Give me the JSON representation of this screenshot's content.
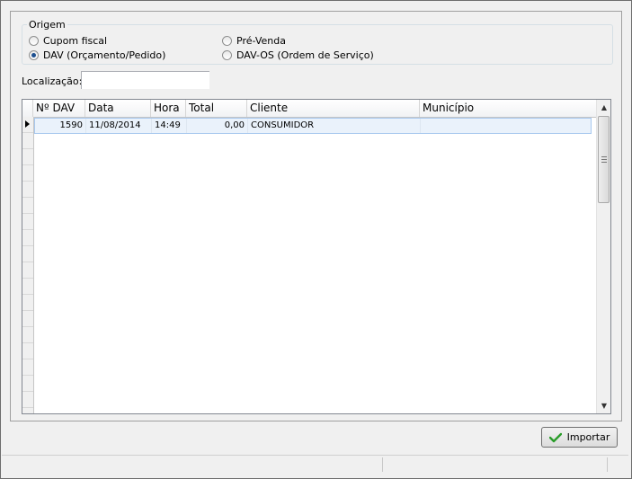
{
  "origem": {
    "title": "Origem",
    "options": [
      {
        "label": "Cupom fiscal",
        "checked": false
      },
      {
        "label": "DAV (Orçamento/Pedido)",
        "checked": true
      },
      {
        "label": "Pré-Venda",
        "checked": false
      },
      {
        "label": "DAV-OS (Ordem de Serviço)",
        "checked": false
      }
    ]
  },
  "search": {
    "label": "Localização:",
    "value": ""
  },
  "grid": {
    "columns": [
      "Nº DAV",
      "Data",
      "Hora",
      "Total",
      "Cliente",
      "Município"
    ],
    "rows": [
      {
        "dav": "1590",
        "data": "11/08/2014",
        "hora": "14:49",
        "total": "0,00",
        "cliente": "CONSUMIDOR",
        "municipio": ""
      }
    ]
  },
  "actions": {
    "import_label": "Importar"
  },
  "colors": {
    "accent": "#2a9d2a",
    "selection": "#eaf2fb"
  }
}
